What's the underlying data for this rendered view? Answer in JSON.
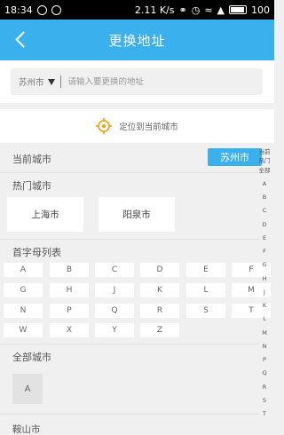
{
  "status_bar": {
    "time": "18:34",
    "network_speed": "2.11 K/s",
    "battery": "100"
  },
  "header": {
    "title": "更换地址",
    "back_icon": "chevron-left-icon"
  },
  "search": {
    "city": "苏州市",
    "placeholder": "请输入要更换的地址"
  },
  "locate": {
    "label": "定位到当前城市",
    "icon": "location-target-icon",
    "icon_color": "#f5a623"
  },
  "current_city": {
    "label": "当前城市",
    "city": "苏州市"
  },
  "hot_cities": {
    "label": "热门城市",
    "items": [
      "上海市",
      "阳泉市"
    ]
  },
  "letters": {
    "label": "首字母列表",
    "rows": [
      [
        "A",
        "B",
        "C",
        "D",
        "E",
        "F"
      ],
      [
        "G",
        "H",
        "J",
        "K",
        "L",
        "M"
      ],
      [
        "N",
        "P",
        "Q",
        "R",
        "S",
        "T"
      ],
      [
        "W",
        "X",
        "Y",
        "Z"
      ]
    ]
  },
  "all_cities": {
    "label": "全部城市",
    "current_letter": "A",
    "first_city": "鞍山市"
  },
  "index_bar": [
    "当前",
    "热门",
    "全部",
    "A",
    "B",
    "C",
    "D",
    "E",
    "F",
    "G",
    "H",
    "J",
    "K",
    "L",
    "M",
    "N",
    "P",
    "Q",
    "R",
    "S",
    "T"
  ],
  "colors": {
    "accent": "#3ab0ec",
    "background": "#f0f0f0"
  }
}
